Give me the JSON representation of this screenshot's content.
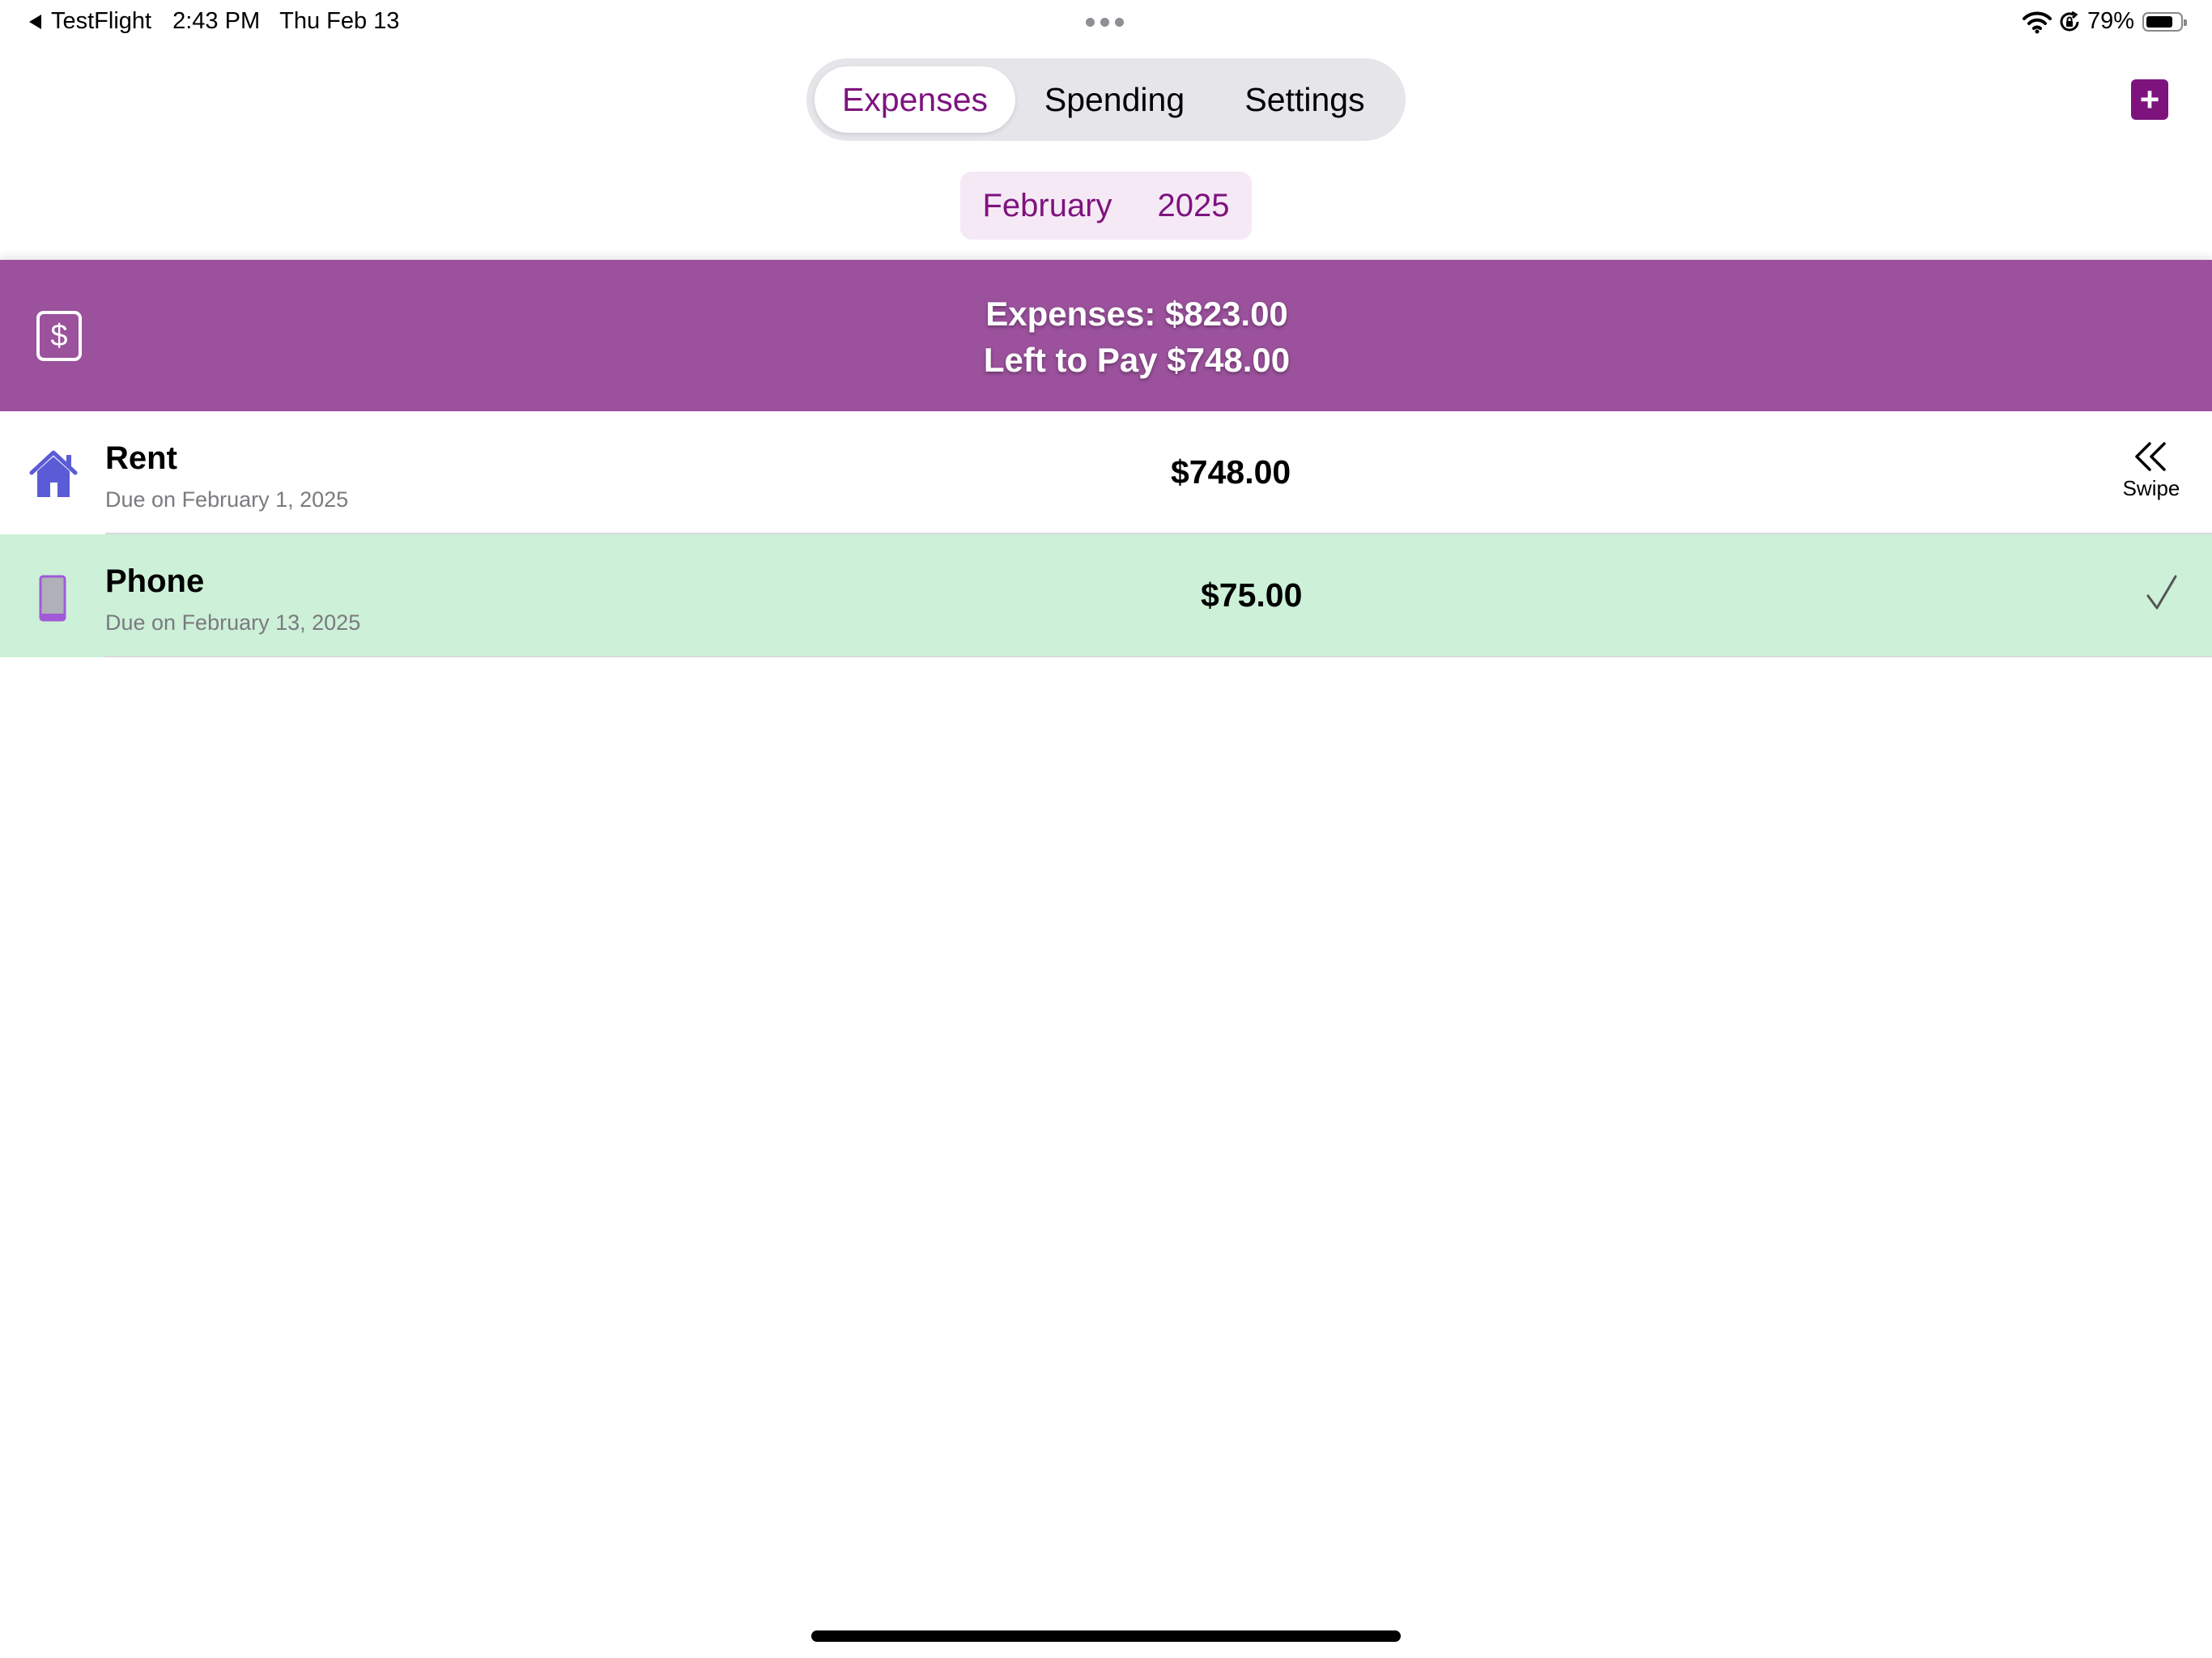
{
  "status_bar": {
    "back_app": "TestFlight",
    "time": "2:43 PM",
    "date": "Thu Feb 13",
    "battery_percent": "79%",
    "battery_level": 0.79
  },
  "tabs": [
    {
      "label": "Expenses",
      "active": true
    },
    {
      "label": "Spending",
      "active": false
    },
    {
      "label": "Settings",
      "active": false
    }
  ],
  "add_button": {
    "symbol": "+",
    "icon": "plus-icon"
  },
  "period": {
    "month": "February",
    "year": "2025"
  },
  "summary": {
    "icon": "dollar-sign-icon",
    "icon_glyph": "$",
    "expenses_text": "Expenses: $823.00",
    "left_to_pay_text": "Left to Pay $748.00"
  },
  "expenses": [
    {
      "title": "Rent",
      "due": "Due on February 1, 2025",
      "amount": "$748.00",
      "icon": "house-icon",
      "paid": false,
      "action_label": "Swipe"
    },
    {
      "title": "Phone",
      "due": "Due on February 13, 2025",
      "amount": "$75.00",
      "icon": "phone-icon",
      "paid": true
    }
  ],
  "colors": {
    "accent": "#7e137e",
    "banner": "#9b519c",
    "paid_row": "#cdf0d8",
    "picker_bg": "#f6e9f6",
    "icon_blue": "#5b5bd6",
    "icon_purple": "#a05ad8"
  }
}
